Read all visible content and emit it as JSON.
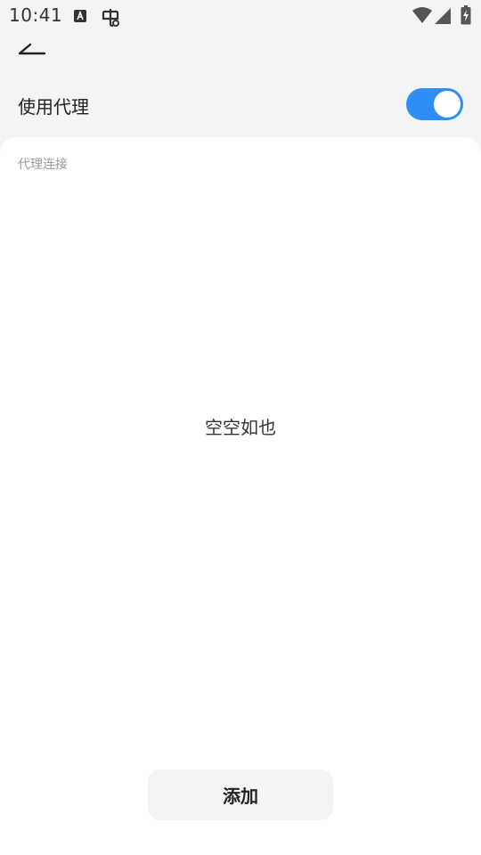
{
  "status_bar": {
    "time": "10:41"
  },
  "settings": {
    "proxy_label": "使用代理",
    "proxy_enabled": true
  },
  "list": {
    "section_label": "代理连接",
    "empty_text": "空空如也"
  },
  "actions": {
    "add_label": "添加"
  },
  "colors": {
    "accent": "#2f8ef6",
    "background": "#f3f4f6",
    "card": "#ffffff"
  },
  "icons": {
    "back": "back-arrow-icon",
    "app": "font-a-icon",
    "bug": "bug-icon",
    "wifi": "wifi-icon",
    "signal": "signal-icon",
    "battery": "battery-charging-icon"
  }
}
